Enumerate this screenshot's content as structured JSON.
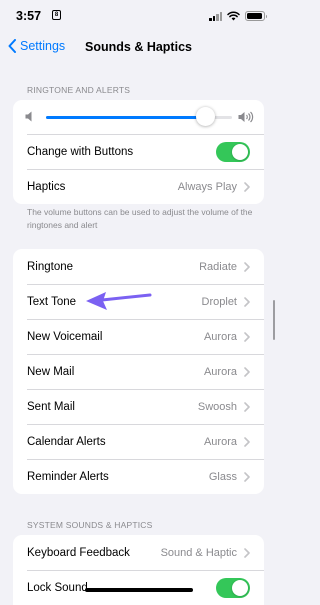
{
  "status_bar": {
    "time": "3:57",
    "sim_badge": "8",
    "battery_level_percent": 95
  },
  "nav": {
    "back_label": "Settings",
    "title": "Sounds & Haptics"
  },
  "ringtone_section": {
    "header": "RINGTONE AND ALERTS",
    "volume_level_fraction": 0.86,
    "change_with_buttons": {
      "label": "Change with Buttons",
      "on": true
    },
    "haptics": {
      "label": "Haptics",
      "value": "Always Play"
    },
    "footnote": "The volume buttons can be used to adjust the volume of the ringtones and alert"
  },
  "tones": [
    {
      "label": "Ringtone",
      "value": "Radiate"
    },
    {
      "label": "Text Tone",
      "value": "Droplet"
    },
    {
      "label": "New Voicemail",
      "value": "Aurora"
    },
    {
      "label": "New Mail",
      "value": "Aurora"
    },
    {
      "label": "Sent Mail",
      "value": "Swoosh"
    },
    {
      "label": "Calendar Alerts",
      "value": "Aurora"
    },
    {
      "label": "Reminder Alerts",
      "value": "Glass"
    }
  ],
  "system_section": {
    "header": "SYSTEM SOUNDS & HAPTICS",
    "keyboard_feedback": {
      "label": "Keyboard Feedback",
      "value": "Sound & Haptic"
    },
    "lock_sound": {
      "label": "Lock Sound",
      "on": true
    }
  },
  "colors": {
    "accent": "#007aff",
    "toggle_on": "#34c759",
    "annotation_arrow": "#7b61f2",
    "background": "#f2f2f7"
  },
  "icons": {
    "back": "chevron-left-icon",
    "row": "chevron-right-icon",
    "volume_low": "speaker-low-icon",
    "volume_high": "speaker-high-icon"
  }
}
